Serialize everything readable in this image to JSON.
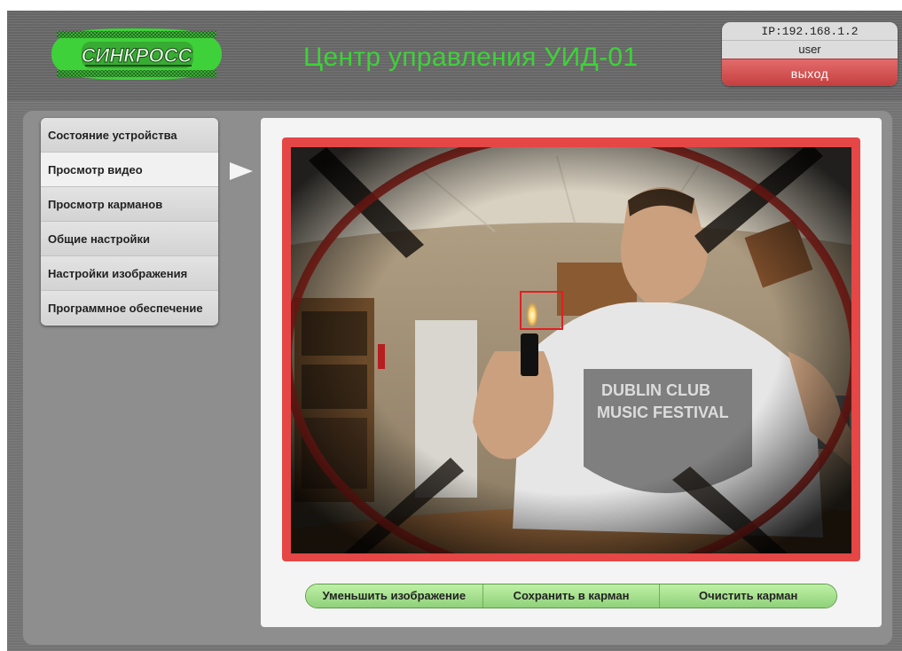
{
  "header": {
    "logo_text": "СИНКРОСС",
    "title": "Центр управления УИД-01"
  },
  "user": {
    "ip": "IP:192.168.1.2",
    "name": "user",
    "logout_label": "выход"
  },
  "sidebar": {
    "items": [
      {
        "label": "Состояние устройства",
        "active": false
      },
      {
        "label": "Просмотр видео",
        "active": true
      },
      {
        "label": "Просмотр карманов",
        "active": false
      },
      {
        "label": "Общие настройки",
        "active": false
      },
      {
        "label": "Настройки изображения",
        "active": false
      },
      {
        "label": "Программное обеспечение",
        "active": false
      }
    ]
  },
  "controls": {
    "shrink_label": "Уменьшить изображение",
    "save_label": "Сохранить в карман",
    "clear_label": "Очистить карман"
  },
  "colors": {
    "accent_green": "#3fd13a",
    "alarm_red": "#e54646",
    "logout_red": "#d04f4f"
  }
}
